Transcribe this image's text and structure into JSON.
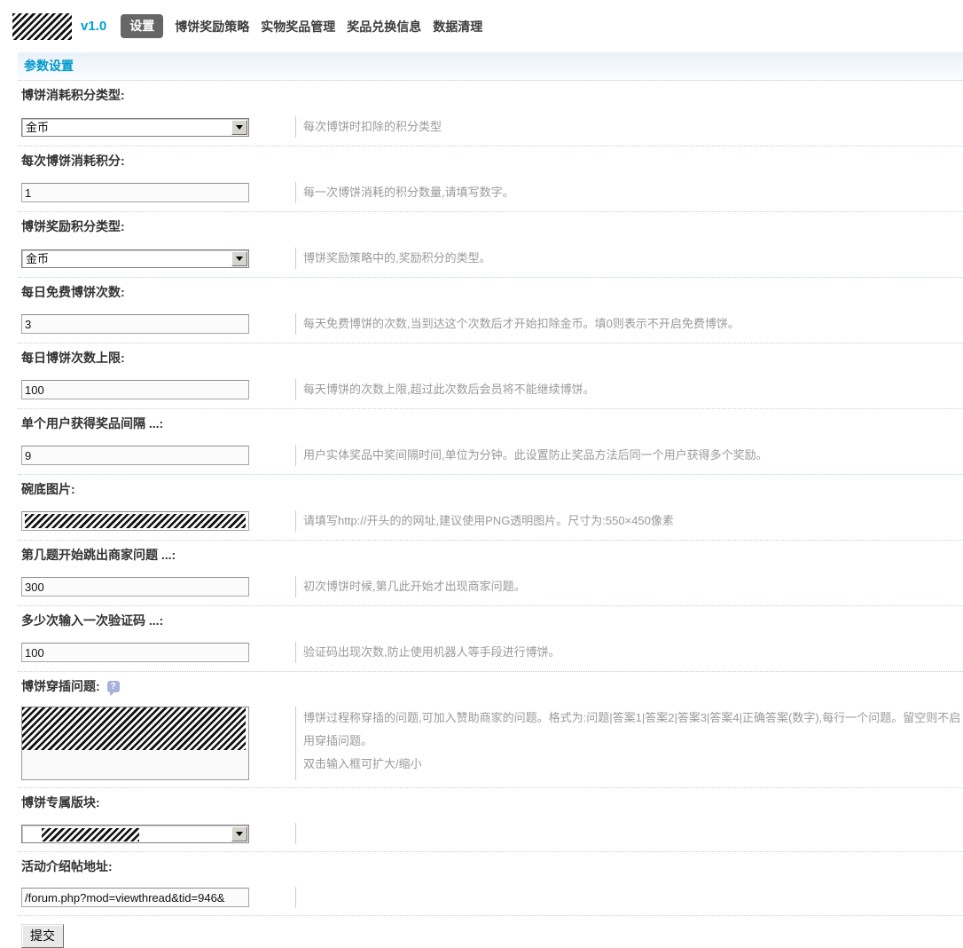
{
  "header": {
    "logo": "redacted-logo",
    "version": "v1.0",
    "tabs": [
      {
        "label": "设置",
        "active": true
      },
      {
        "label": "博饼奖励策略",
        "active": false
      },
      {
        "label": "实物奖品管理",
        "active": false
      },
      {
        "label": "奖品兑换信息",
        "active": false
      },
      {
        "label": "数据清理",
        "active": false
      }
    ]
  },
  "section": {
    "title": "参数设置"
  },
  "icons": {
    "help": "?",
    "dropdown": "down-arrow"
  },
  "colors": {
    "accent_blue": "#0099cc",
    "version_blue": "#00a0d5",
    "active_tab_bg": "#666666",
    "label_text": "#333333",
    "description_text": "#9a9a9a",
    "row_divider": "#b9d4e4"
  },
  "form": {
    "rows": [
      {
        "name": "consume-credit-type",
        "label": "博饼消耗积分类型:",
        "control": "select",
        "value": "金币",
        "desc": "每次博饼时扣除的积分类型"
      },
      {
        "name": "consume-credits-per-play",
        "label": "每次博饼消耗积分:",
        "control": "input",
        "value": "1",
        "desc": "每一次博饼消耗的积分数量,请填写数字。"
      },
      {
        "name": "reward-credit-type",
        "label": "博饼奖励积分类型:",
        "control": "select",
        "value": "金币",
        "desc": "博饼奖励策略中的,奖励积分的类型。"
      },
      {
        "name": "free-plays-per-day",
        "label": "每日免费博饼次数:",
        "control": "input",
        "value": "3",
        "desc": "每天免费博饼的次数,当到达这个次数后才开始扣除金币。填0则表示不开启免费博饼。"
      },
      {
        "name": "max-plays-per-day",
        "label": "每日博饼次数上限:",
        "control": "input",
        "value": "100",
        "desc": "每天博饼的次数上限,超过此次数后会员将不能继续博饼。"
      },
      {
        "name": "prize-win-interval",
        "label": "单个用户获得奖品间隔 ...:",
        "control": "input",
        "value": "9",
        "desc": "用户实体奖品中奖间隔时间,单位为分钟。此设置防止奖品方法后同一个用户获得多个奖励。"
      },
      {
        "name": "bowl-image-url",
        "label": "碗底图片:",
        "control": "input-redacted",
        "value": "",
        "desc": "请填写http://开头的的网址,建议使用PNG透明图片。尺寸为:550×450像素"
      },
      {
        "name": "merchant-question-start",
        "label": "第几题开始跳出商家问题 ...:",
        "control": "input",
        "value": "300",
        "desc": "初次博饼时候,第几此开始才出现商家问题。"
      },
      {
        "name": "captcha-frequency",
        "label": "多少次输入一次验证码 ...:",
        "control": "input",
        "value": "100",
        "desc": "验证码出现次数,防止使用机器人等手段进行博饼。"
      },
      {
        "name": "inserted-questions",
        "label": "博饼穿插问题:",
        "control": "textarea-redacted",
        "value": "",
        "help": true,
        "desc": "博饼过程称穿插的问题,可加入赞助商家的问题。格式为:问题|答案1|答案2|答案3|答案4|正确答案(数字),每行一个问题。留空则不启用穿插问题。",
        "desc2": "双击输入框可扩大/缩小"
      },
      {
        "name": "exclusive-forum",
        "label": "博饼专属版块:",
        "control": "select-redacted",
        "value": "",
        "desc": ""
      },
      {
        "name": "intro-thread-url",
        "label": "活动介绍帖地址:",
        "control": "input",
        "value": "/forum.php?mod=viewthread&tid=946&",
        "desc": ""
      }
    ],
    "submit_label": "提交"
  }
}
